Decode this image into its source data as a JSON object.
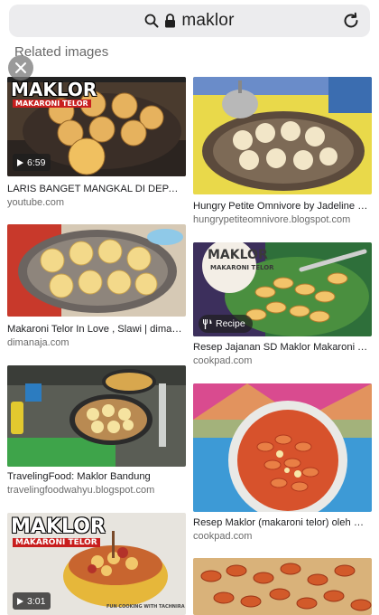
{
  "address_bar": {
    "query": "maklor"
  },
  "section": {
    "title": "Related images"
  },
  "results": [
    {
      "title": "LARIS BANGET MANGKAL DI DEPAN S...",
      "source": "youtube.com",
      "duration": "6:59",
      "overlay_title": "MAKLOR",
      "overlay_sub": "MAKARONI TELOR"
    },
    {
      "title": "Hungry Petite Omnivore by Jadeline Oz...",
      "source": "hungrypetiteomnivore.blogspot.com"
    },
    {
      "title": "Makaroni Telor In Love , Slawi | dimana...",
      "source": "dimanaja.com"
    },
    {
      "title": "Resep Jajanan SD Maklor Makaroni Te...",
      "source": "cookpad.com",
      "badge": "Recipe",
      "overlay_title": "MAKLOR",
      "overlay_sub": "MAKARONI TELOR"
    },
    {
      "title": "TravelingFood: Maklor Bandung",
      "source": "travelingfoodwahyu.blogspot.com"
    },
    {
      "title": "Resep Maklor (makaroni telor) oleh Ni...",
      "source": "cookpad.com"
    },
    {
      "duration": "3:01",
      "overlay_title": "MAKLOR",
      "overlay_sub": "MAKARONI TELOR",
      "watermark": "FUN COOKING WITH TACHNIRA"
    },
    {}
  ],
  "colors": {
    "url_bar_bg": "#ececee",
    "muted_text": "#6b6b6b",
    "title_text": "#202124"
  },
  "icons": [
    "search-icon",
    "lock-icon",
    "reload-icon",
    "close-icon",
    "play-icon",
    "recipe-utensils-icon"
  ]
}
